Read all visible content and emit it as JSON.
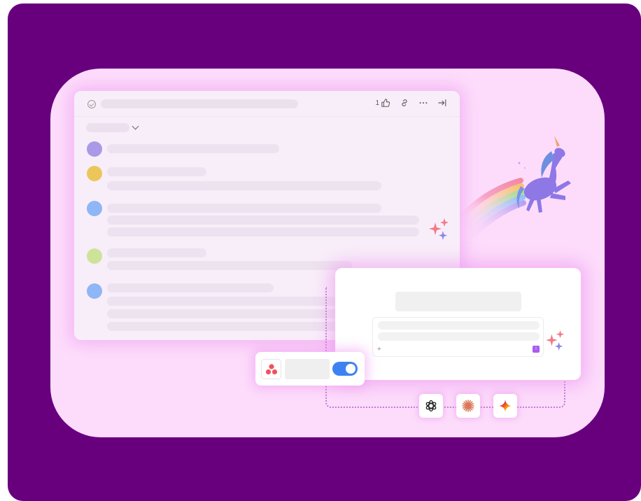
{
  "task": {
    "like_count": "1"
  },
  "colors": {
    "frame": "#68007e",
    "stage": "#fddcfb",
    "avatar_1": "#a999e6",
    "avatar_2": "#ebc65a",
    "avatar_3": "#8fb6f5",
    "avatar_4": "#cde39a",
    "avatar_5": "#8fb6f5",
    "toggle": "#3d82f2",
    "send": "#a95cf0"
  },
  "ai_card": {
    "plus_label": "+",
    "send_label": "↑"
  },
  "icons": {
    "header": [
      "check-circle-icon",
      "thumbs-up-icon",
      "link-icon",
      "more-icon",
      "collapse-icon"
    ],
    "integration": "asana-icon",
    "models": [
      "openai-icon",
      "claude-icon",
      "gemini-icon"
    ],
    "decor": [
      "sparkles-icon",
      "unicorn-illustration"
    ]
  }
}
